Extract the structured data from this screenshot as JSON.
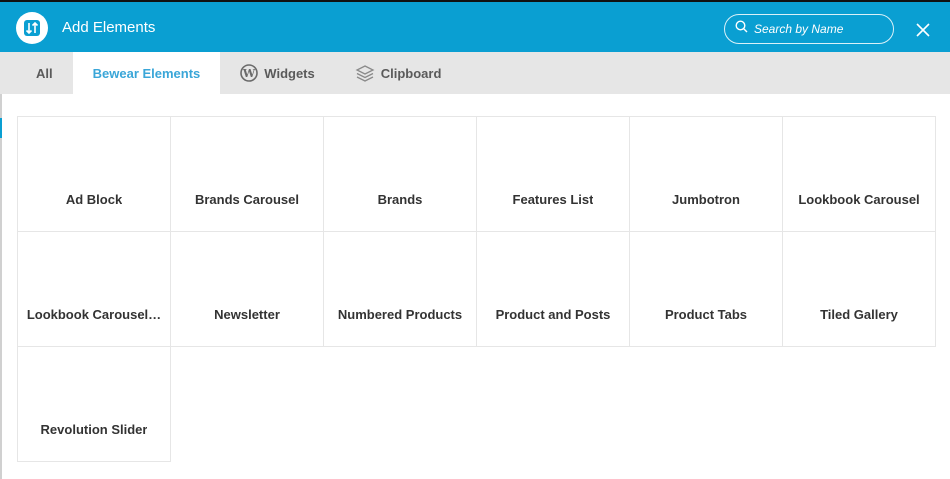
{
  "header": {
    "title": "Add Elements",
    "logo_icon": "updown-arrows-icon",
    "search_placeholder": "Search by Name",
    "close_icon": "close-icon",
    "accent": "#0a9fd2"
  },
  "tabs": [
    {
      "label": "All",
      "active": false
    },
    {
      "label": "Bewear Elements",
      "active": true
    },
    {
      "label": "Widgets",
      "icon": "wordpress-icon",
      "active": false
    },
    {
      "label": "Clipboard",
      "icon": "layers-icon",
      "active": false
    }
  ],
  "elements": [
    "Ad Block",
    "Brands Carousel",
    "Brands",
    "Features List",
    "Jumbotron",
    "Lookbook Carousel",
    "Lookbook Carousel…",
    "Newsletter",
    "Numbered Products",
    "Product and Posts",
    "Product Tabs",
    "Tiled Gallery",
    "Revolution Slider"
  ]
}
